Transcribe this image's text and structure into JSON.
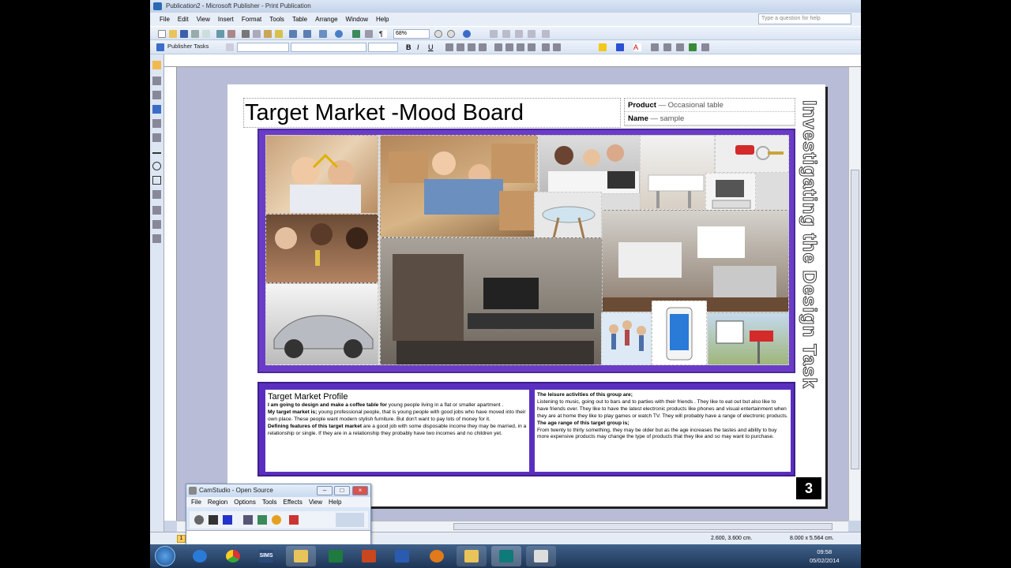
{
  "window": {
    "title": "Publication2 - Microsoft Publisher - Print Publication"
  },
  "menu": {
    "items": [
      "File",
      "Edit",
      "View",
      "Insert",
      "Format",
      "Tools",
      "Table",
      "Arrange",
      "Window",
      "Help"
    ],
    "help_placeholder": "Type a question for help"
  },
  "toolbar": {
    "zoom": "68%",
    "publisher_tasks": "Publisher Tasks"
  },
  "status": {
    "page": "1",
    "position": "2.600, 3.600 cm.",
    "size": "8.000 x 5.564 cm."
  },
  "page": {
    "title": "Target Market -Mood Board",
    "product_label": "Product",
    "product_value": " — Occasional table",
    "name_label": "Name",
    "name_value": " — sample",
    "side_title": "Investigating the Design Task",
    "page_number": "3"
  },
  "mood_board": {
    "images": [
      "couple-house-keys",
      "couple-moving-boxes",
      "friends-laptop",
      "white-kitchen",
      "car-keys",
      "friends-champagne",
      "tv-unit",
      "glass-table",
      "modern-kitchen-living",
      "sports-car",
      "jumping-friends",
      "smartphone",
      "sold-sign"
    ]
  },
  "profile": {
    "heading": "Target Market Profile",
    "p1_bold": "I am going to design and make a coffee table for",
    "p1": " young people living in a flat or smaller apartment .",
    "p2_bold": "My target market is;",
    "p2": " young professional people, that is young people with good jobs who have moved into their own place. These people want  modern stylish furniture. But don't want to pay lots of money for it.",
    "p3_bold": "Defining features of this target market",
    "p3": " are a good job with some disposable income they may be married, in a relationship or single. If they are in a relationship they probably have two incomes and no children yet."
  },
  "leisure": {
    "h1": "The leisure activities of this group are;",
    "t1": "Listening to music, going out to bars and to parties with their friends . They like to eat out but also like to have friends over.  They like to have the latest electronic products like phones and visual entertainment when they are at home they like to play games or watch TV. They will probably have a range of electronic products.",
    "h2": "The age range of this target group is;",
    "t2": "From twenty to thirty something, they may be older but as the age increases the tastes and ability to buy more expensive products may change the type of products that they like and so may want to purchase."
  },
  "camstudio": {
    "title": "CamStudio - Open Source",
    "menu": [
      "File",
      "Region",
      "Options",
      "Tools",
      "Effects",
      "View",
      "Help"
    ]
  },
  "taskbar": {
    "apps": [
      "ie",
      "chrome",
      "sims",
      "folder-mail",
      "excel",
      "powerpoint",
      "word",
      "media",
      "explorer",
      "publisher",
      "other"
    ],
    "sims_label": "SIMS",
    "time": "09:58",
    "date": "05/02/2014"
  }
}
